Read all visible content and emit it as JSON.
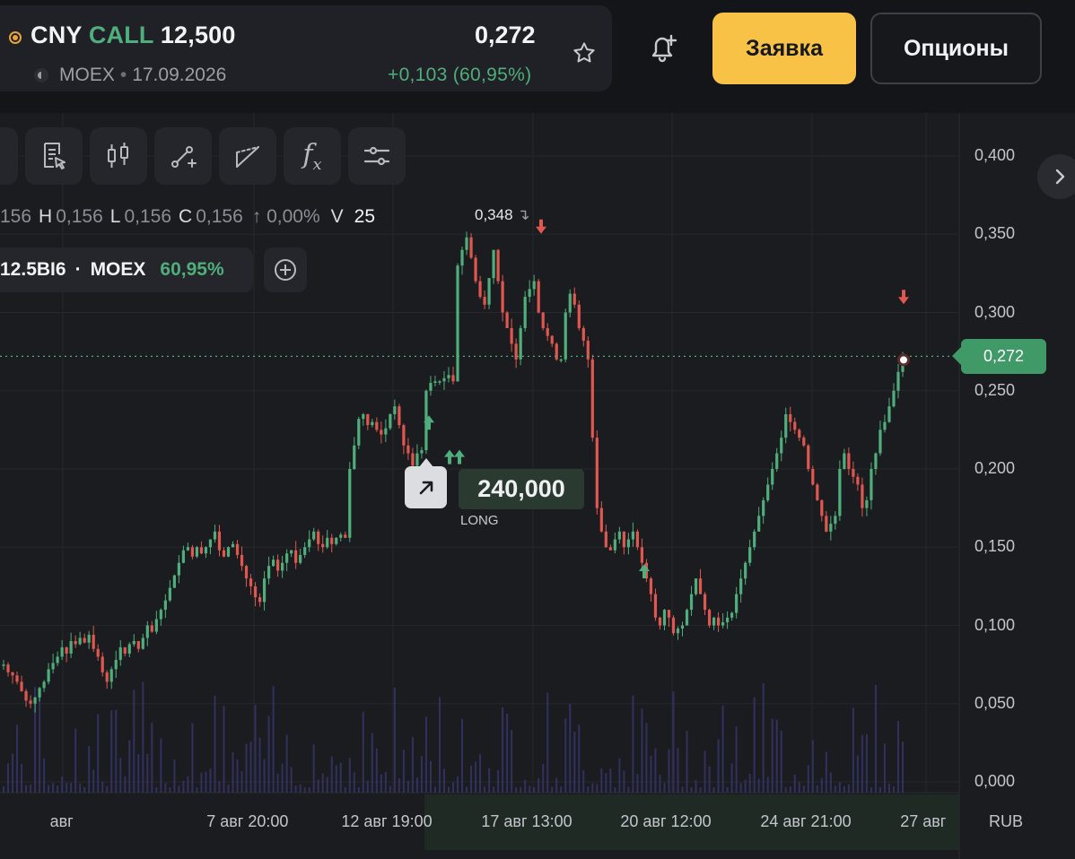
{
  "header": {
    "ticker_symbol": "CNY",
    "ticker_type": "CALL",
    "ticker_strike": "12,500",
    "exchange": "MOEX",
    "expiry": "17.09.2026",
    "price": "0,272",
    "change": "+0,103",
    "change_pct": "(60,95%)",
    "order_button": "Заявка",
    "options_button": "Опционы"
  },
  "toolbar": {
    "tools": [
      "template-icon",
      "candles-icon",
      "line-draw-icon",
      "fib-icon",
      "fx-icon",
      "settings-icon"
    ],
    "fx_label": "f",
    "fx_sub": "x"
  },
  "ohlc": {
    "o_partial": "156",
    "h_label": "H",
    "h_value": "0,156",
    "l_label": "L",
    "l_value": "0,156",
    "c_label": "C",
    "c_value": "0,156",
    "change": "↑ 0,00%",
    "v_label": "V",
    "v_value": "25"
  },
  "legend": {
    "symbol": "12.5BI6",
    "exchange": "MOEX",
    "pct": "60,95%"
  },
  "annotations": {
    "high_label": "0,348",
    "current_price": "0,272",
    "trade_qty": "240,000",
    "trade_side": "LONG"
  },
  "chart_data": {
    "type": "candlestick",
    "y_ticks": [
      "0,400",
      "0,350",
      "0,300",
      "0,250",
      "0,200",
      "0,150",
      "0,100",
      "0,050",
      "0,000"
    ],
    "ylim": [
      0,
      0.4
    ],
    "x_ticks": [
      "авг",
      "7 авг 20:00",
      "12 авг 19:00",
      "17 авг 13:00",
      "20 авг 12:00",
      "24 авг 21:00",
      "27 авг"
    ],
    "currency": "RUB",
    "last_price": 0.272,
    "high": 0.348,
    "closes": [
      0.075,
      0.07,
      0.068,
      0.064,
      0.058,
      0.052,
      0.05,
      0.054,
      0.06,
      0.064,
      0.072,
      0.076,
      0.08,
      0.086,
      0.082,
      0.09,
      0.088,
      0.092,
      0.089,
      0.094,
      0.085,
      0.08,
      0.07,
      0.064,
      0.072,
      0.078,
      0.086,
      0.082,
      0.088,
      0.09,
      0.085,
      0.092,
      0.1,
      0.096,
      0.104,
      0.11,
      0.116,
      0.124,
      0.132,
      0.14,
      0.148,
      0.15,
      0.144,
      0.15,
      0.146,
      0.15,
      0.155,
      0.16,
      0.148,
      0.144,
      0.15,
      0.152,
      0.145,
      0.138,
      0.13,
      0.125,
      0.118,
      0.115,
      0.13,
      0.138,
      0.142,
      0.135,
      0.14,
      0.146,
      0.148,
      0.14,
      0.145,
      0.15,
      0.155,
      0.16,
      0.152,
      0.15,
      0.156,
      0.152,
      0.156,
      0.158,
      0.156,
      0.2,
      0.215,
      0.232,
      0.235,
      0.228,
      0.23,
      0.225,
      0.222,
      0.226,
      0.235,
      0.24,
      0.228,
      0.215,
      0.21,
      0.202,
      0.21,
      0.212,
      0.25,
      0.255,
      0.256,
      0.256,
      0.258,
      0.26,
      0.256,
      0.33,
      0.34,
      0.348,
      0.335,
      0.32,
      0.31,
      0.305,
      0.322,
      0.34,
      0.32,
      0.3,
      0.29,
      0.28,
      0.27,
      0.29,
      0.31,
      0.315,
      0.32,
      0.3,
      0.29,
      0.285,
      0.28,
      0.27,
      0.27,
      0.3,
      0.312,
      0.305,
      0.29,
      0.282,
      0.27,
      0.22,
      0.175,
      0.16,
      0.15,
      0.148,
      0.155,
      0.16,
      0.15,
      0.155,
      0.16,
      0.15,
      0.14,
      0.13,
      0.12,
      0.105,
      0.1,
      0.11,
      0.105,
      0.095,
      0.098,
      0.1,
      0.11,
      0.12,
      0.13,
      0.12,
      0.11,
      0.1,
      0.105,
      0.1,
      0.102,
      0.105,
      0.108,
      0.12,
      0.13,
      0.14,
      0.15,
      0.16,
      0.17,
      0.18,
      0.19,
      0.2,
      0.21,
      0.22,
      0.235,
      0.23,
      0.225,
      0.22,
      0.215,
      0.2,
      0.19,
      0.18,
      0.17,
      0.16,
      0.165,
      0.17,
      0.2,
      0.21,
      0.2,
      0.195,
      0.19,
      0.175,
      0.18,
      0.2,
      0.21,
      0.225,
      0.23,
      0.24,
      0.25,
      0.262,
      0.272
    ],
    "buy_marks": [
      0.24,
      0.218,
      0.218,
      0.145
    ],
    "sell_marks": [
      0.348,
      0.303
    ]
  }
}
